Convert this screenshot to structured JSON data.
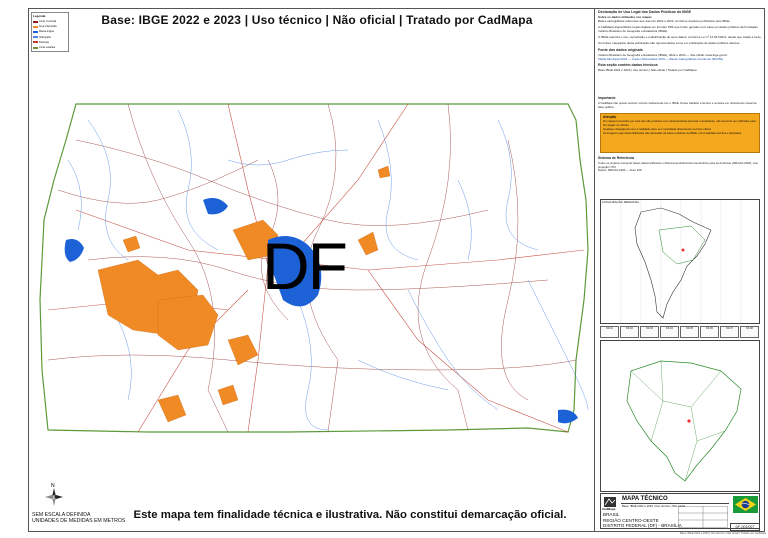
{
  "header": {
    "title": "Base: IBGE 2022 e 2023 | Uso técnico | Não oficial | Tratado por CadMapa"
  },
  "map": {
    "main_label": "DF",
    "footer_note": "Este mapa tem finalidade técnica e ilustrativa. Não constitui demarcação oficial."
  },
  "scale": {
    "line1": "SEM ESCALA DEFINIDA",
    "line2": "UNIDADES DE MEDIDAS EM METROS"
  },
  "legend": {
    "title": "Legenda",
    "items": [
      {
        "label": "Limite municipal",
        "color": "#8b1f1f"
      },
      {
        "label": "Área urbanizada",
        "color": "#f08a24"
      },
      {
        "label": "Massa d'água",
        "color": "#1c62d6"
      },
      {
        "label": "Hidrografia",
        "color": "#4a86e8"
      },
      {
        "label": "Rodovias",
        "color": "#c0392b"
      },
      {
        "label": "Limite estadual",
        "color": "#6e8f3a"
      }
    ]
  },
  "colors": {
    "urban": "#f08a24",
    "water": "#1c62d6",
    "river": "#4a86e8",
    "road": "#c0392b",
    "state_border": "#5c9a3a",
    "warning_bg": "#f3a81d",
    "flag": "#1a9b3a"
  },
  "panel": {
    "decl_title": "Declaração de Uso Legal dos Dados Públicos do IBGE",
    "decl_sub": "Sobre os dados utilizados nos mapas",
    "decl_text_1": "Bases cartográficas referentes aos anos de 2022 e 2023, conforme arquivos publicados pelo IBGE.",
    "decl_text_2": "A CadMapa disponibiliza mapas digitais em formato PDF que foram gerados com base em dados públicos da Fundação Instituto Brasileiro de Geografia e Estatística (IBGE).",
    "decl_text_3": "O IBGE autoriza o uso, reprodução e redistribuição de seus dados, conforme Lei nº 12.527/2011, desde que citada a fonte.",
    "decl_text_4": "Os limites mapeados desta publicação são representados como em publicação de dados públicos abertos.",
    "sources_title": "Fonte dos dados originais",
    "sources_text": "Instituto Brasileiro de Geografia e Estatística (IBGE), 2022 e 2023 — Site oficial: www.ibge.gov.br",
    "sources_links": "Malha Municipal 2022 — Áreas Urbanizadas 2019 — Bases Cartográficas Contínuas (BC250)",
    "info_title": "Esta seção contém dados técnicos",
    "info_text": "Base IBGE 2022 e 2023 | Uso técnico | Não oficial | Tratado por CadMapa",
    "import_title": "Importante",
    "import_text": "A CadMapa não possui nenhum vínculo institucional com o IBGE. Nosso trabalho é técnico e consiste em refinamento visual da base pública.",
    "warn_title": "Atenção",
    "warn_text_1": "Os mapas fornecidos por este site são produtos com características técnicas e ilustrativas, não devendo ser utilizados para fins legais ou oficiais.",
    "warn_text_2": "Qualquer divergência com a realidade deve ser consultada diretamente na fonte oficial.",
    "warn_text_3": "As imagens aqui disponibilizadas são derivadas de bases públicas do IBGE, com finalidade técnica e ilustrativa.",
    "ref_title": "Sistema de Referência",
    "ref_text": "Todos os projetos contendo bases dados utilizando o Sistema de Referência Geocêntrico para as Américas (SIRGAS 2000), com projeção UTM.",
    "ref_text_2": "Datum: SIRGAS 2000 — Fuso 23S",
    "loc_label": "LOCALIZAÇÃO REGIONAL"
  },
  "tiles": [
    "DF-01",
    "DF-02",
    "DF-03",
    "DF-04",
    "DF-05",
    "DF-06",
    "DF-07",
    "DF-08"
  ],
  "titleblock": {
    "logo_text": "CadMapa",
    "title": "MAPA TÉCNICO",
    "sub": "Base: IBGE 2022 e 2023 | Uso técnico | Não oficial",
    "country": "BRASIL",
    "region": "REGIÃO CENTRO-OESTE",
    "state": "DISTRITO FEDERAL (DF) - BRASÍLIA",
    "code": "DF-001/027"
  },
  "credit": "Base: IBGE 2022 e 2023 | Uso técnico | Não oficial | Tratado por CadMapa"
}
